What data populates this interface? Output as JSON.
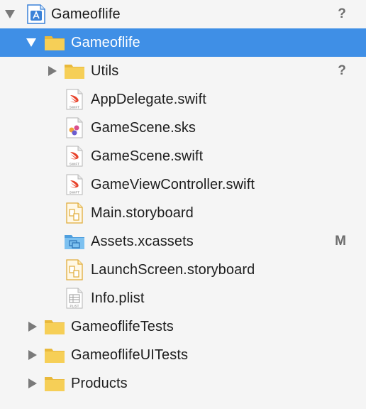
{
  "colors": {
    "selection": "#3f8fe6",
    "folder": "#f6cf57",
    "blue_folder": "#6bb8ee",
    "swift": "#e8422b",
    "status": "#6e6e6e"
  },
  "tree": {
    "project": {
      "label": "Gameoflife",
      "status": "?",
      "icon": "xcode-project-icon",
      "expanded": true
    },
    "group_gameoflife": {
      "label": "Gameoflife",
      "status": "",
      "icon": "folder-icon",
      "expanded": true,
      "selected": true
    },
    "utils": {
      "label": "Utils",
      "status": "?",
      "icon": "folder-icon",
      "expanded": false
    },
    "app_delegate": {
      "label": "AppDelegate.swift",
      "status": "",
      "icon": "swift-file-icon",
      "badge": "SWIFT"
    },
    "game_scene_sks": {
      "label": "GameScene.sks",
      "status": "",
      "icon": "spritekit-scene-icon"
    },
    "game_scene_swift": {
      "label": "GameScene.swift",
      "status": "",
      "icon": "swift-file-icon",
      "badge": "SWIFT"
    },
    "game_view_controller": {
      "label": "GameViewController.swift",
      "status": "",
      "icon": "swift-file-icon",
      "badge": "SWIFT"
    },
    "main_storyboard": {
      "label": "Main.storyboard",
      "status": "",
      "icon": "storyboard-icon"
    },
    "assets": {
      "label": "Assets.xcassets",
      "status": "M",
      "icon": "asset-catalog-icon"
    },
    "launch_screen": {
      "label": "LaunchScreen.storyboard",
      "status": "",
      "icon": "storyboard-icon"
    },
    "info_plist": {
      "label": "Info.plist",
      "status": "",
      "icon": "plist-file-icon",
      "badge": "PLIST"
    },
    "tests": {
      "label": "GameoflifeTests",
      "status": "",
      "icon": "folder-icon",
      "expanded": false
    },
    "ui_tests": {
      "label": "GameoflifeUITests",
      "status": "",
      "icon": "folder-icon",
      "expanded": false
    },
    "products": {
      "label": "Products",
      "status": "",
      "icon": "folder-icon",
      "expanded": false
    }
  }
}
